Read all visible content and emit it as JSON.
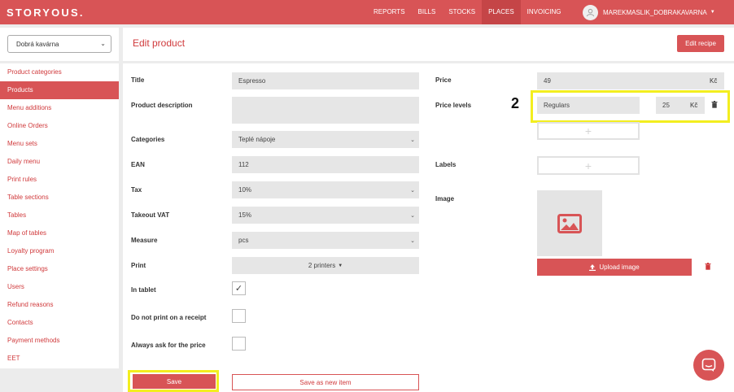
{
  "app": {
    "logo": "STORYOUS."
  },
  "nav": {
    "items": [
      {
        "label": "REPORTS"
      },
      {
        "label": "BILLS"
      },
      {
        "label": "STOCKS"
      },
      {
        "label": "PLACES"
      },
      {
        "label": "INVOICING"
      }
    ],
    "active": "PLACES",
    "user": "MAREKMASLIK_DOBRAKAVARNA"
  },
  "sidebar": {
    "place": "Dobrá kavárna",
    "items": [
      {
        "label": "Product categories"
      },
      {
        "label": "Products"
      },
      {
        "label": "Menu additions"
      },
      {
        "label": "Online Orders"
      },
      {
        "label": "Menu sets"
      },
      {
        "label": "Daily menu"
      },
      {
        "label": "Print rules"
      },
      {
        "label": "Table sections"
      },
      {
        "label": "Tables"
      },
      {
        "label": "Map of tables"
      },
      {
        "label": "Loyalty program"
      },
      {
        "label": "Place settings"
      },
      {
        "label": "Users"
      },
      {
        "label": "Refund reasons"
      },
      {
        "label": "Contacts"
      },
      {
        "label": "Payment methods"
      },
      {
        "label": "EET"
      }
    ],
    "active": "Products"
  },
  "page": {
    "title": "Edit product",
    "edit_recipe": "Edit recipe"
  },
  "form": {
    "title": {
      "label": "Title",
      "value": "Espresso"
    },
    "description": {
      "label": "Product description",
      "value": ""
    },
    "categories": {
      "label": "Categories",
      "value": "Teplé nápoje"
    },
    "ean": {
      "label": "EAN",
      "value": "112"
    },
    "tax": {
      "label": "Tax",
      "value": "10%"
    },
    "takeout_vat": {
      "label": "Takeout VAT",
      "value": "15%"
    },
    "measure": {
      "label": "Measure",
      "value": "pcs"
    },
    "print": {
      "label": "Print",
      "value": "2 printers"
    },
    "in_tablet": {
      "label": "In tablet",
      "checked": true
    },
    "no_print_receipt": {
      "label": "Do not print on a receipt",
      "checked": false
    },
    "ask_price": {
      "label": "Always ask for the price",
      "checked": false
    },
    "save": "Save",
    "save_new": "Save as new item"
  },
  "right": {
    "price": {
      "label": "Price",
      "value": "49",
      "currency": "Kč"
    },
    "price_levels": {
      "label": "Price levels",
      "name": "Regulars",
      "value": "25",
      "currency": "Kč"
    },
    "labels": {
      "label": "Labels"
    },
    "image": {
      "label": "Image",
      "upload": "Upload image"
    },
    "step": "2"
  },
  "icons": {
    "plus": "+",
    "check": "✓",
    "trash": "🗑",
    "chevron": "⌄"
  },
  "colors": {
    "accent": "#d85456",
    "highlight": "#f3ee1f"
  }
}
